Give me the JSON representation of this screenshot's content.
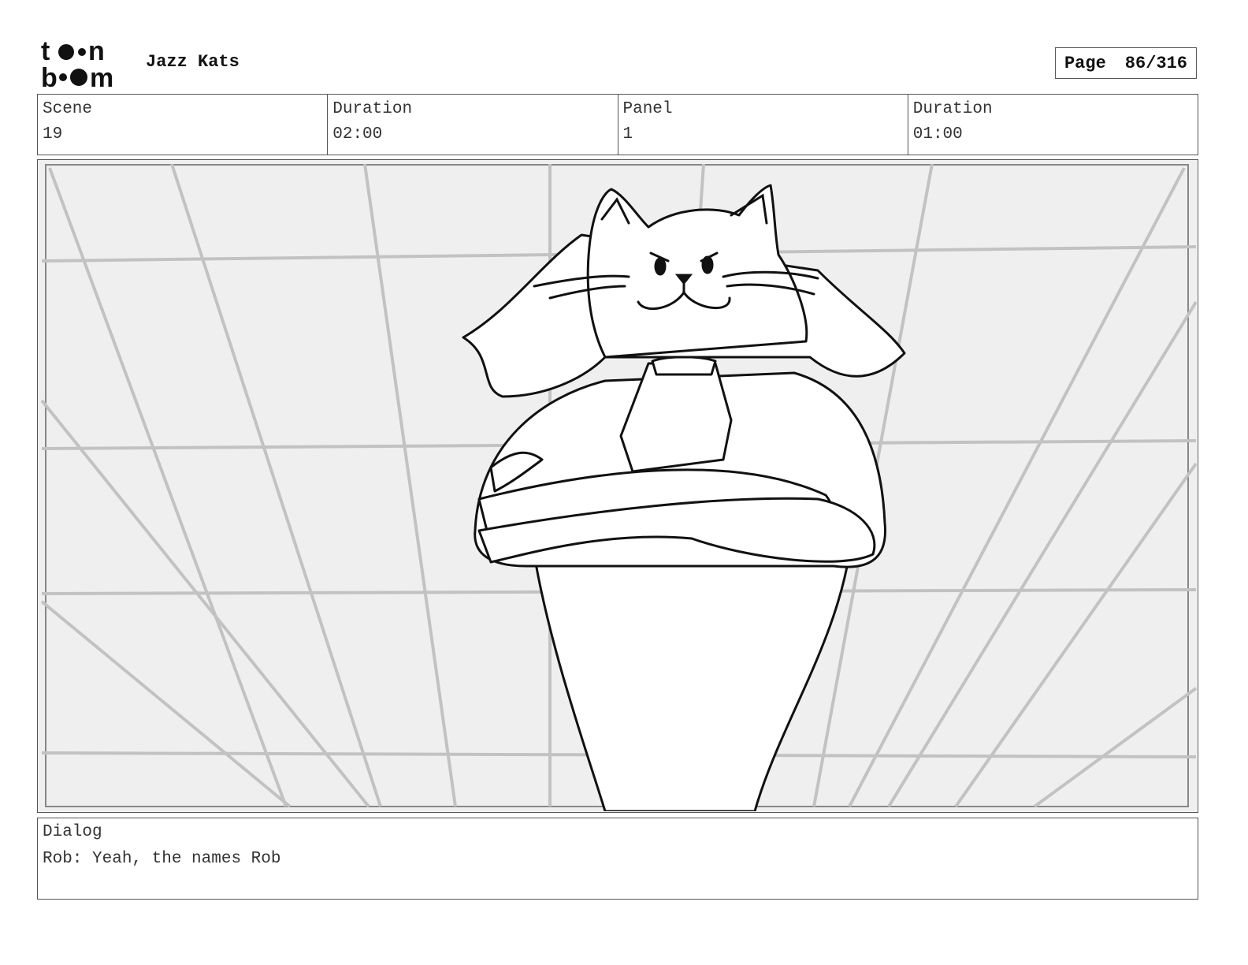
{
  "header": {
    "logo_text": "toon boom",
    "project_title": "Jazz Kats",
    "page_label": "Page",
    "page_value": "86/316"
  },
  "info": {
    "scene_label": "Scene",
    "scene_value": "19",
    "scene_duration_label": "Duration",
    "scene_duration_value": "02:00",
    "panel_label": "Panel",
    "panel_value": "1",
    "panel_duration_label": "Duration",
    "panel_duration_value": "01:00"
  },
  "dialog": {
    "label": "Dialog",
    "text": "Rob: Yeah, the names Rob"
  }
}
